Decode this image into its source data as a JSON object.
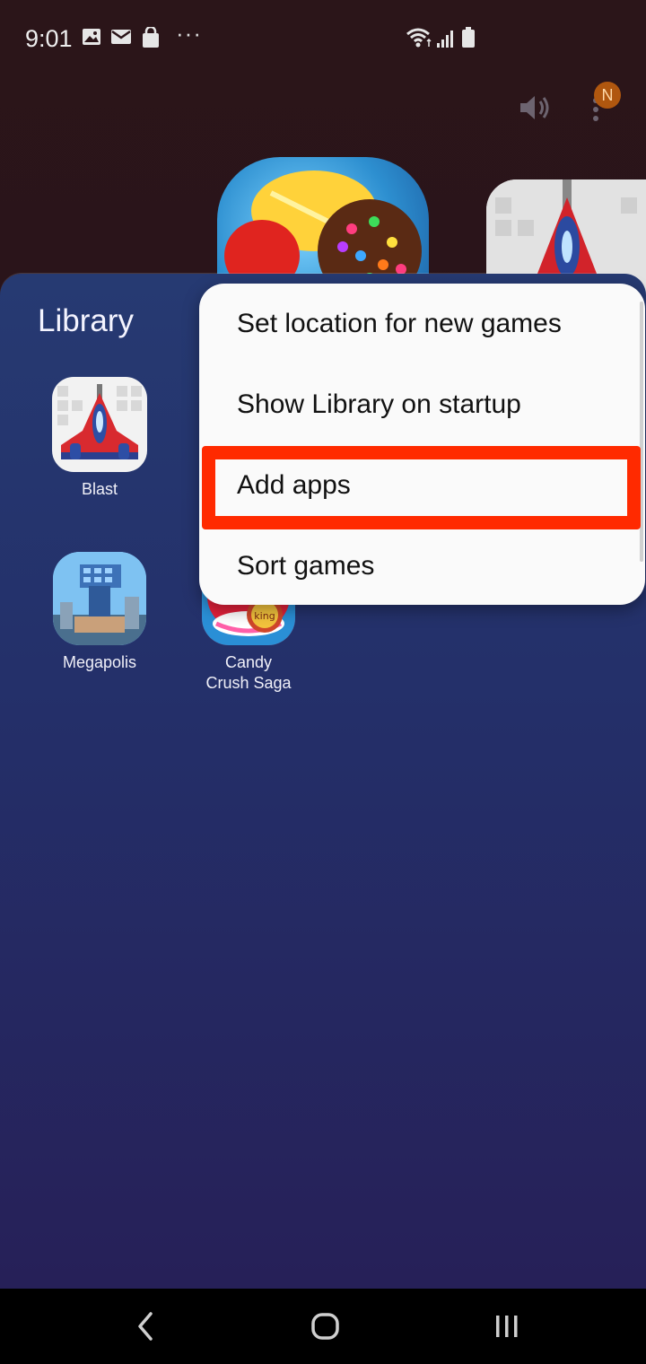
{
  "status_bar": {
    "time": "9:01",
    "more": "···"
  },
  "launcher": {
    "notification_badge": "N"
  },
  "library": {
    "title": "Library",
    "apps": [
      {
        "label": "Blast"
      },
      {
        "label": "Megapolis"
      },
      {
        "label": "Candy\nCrush Saga"
      }
    ]
  },
  "menu": {
    "items": [
      {
        "label": "Set location for new games"
      },
      {
        "label": "Show Library on startup"
      },
      {
        "label": "Add apps"
      },
      {
        "label": "Sort games"
      }
    ],
    "highlighted_item": "Add apps",
    "highlight_color": "#ff2a00"
  },
  "colors": {
    "sheet": "#263a72",
    "menu_background": "#fafafa"
  },
  "icons": {
    "status": [
      "gallery-icon",
      "email-icon",
      "shopping-bag-icon",
      "wifi-icon",
      "signal-icon",
      "battery-icon"
    ],
    "nav": [
      "back-icon",
      "home-icon",
      "recents-icon"
    ]
  }
}
